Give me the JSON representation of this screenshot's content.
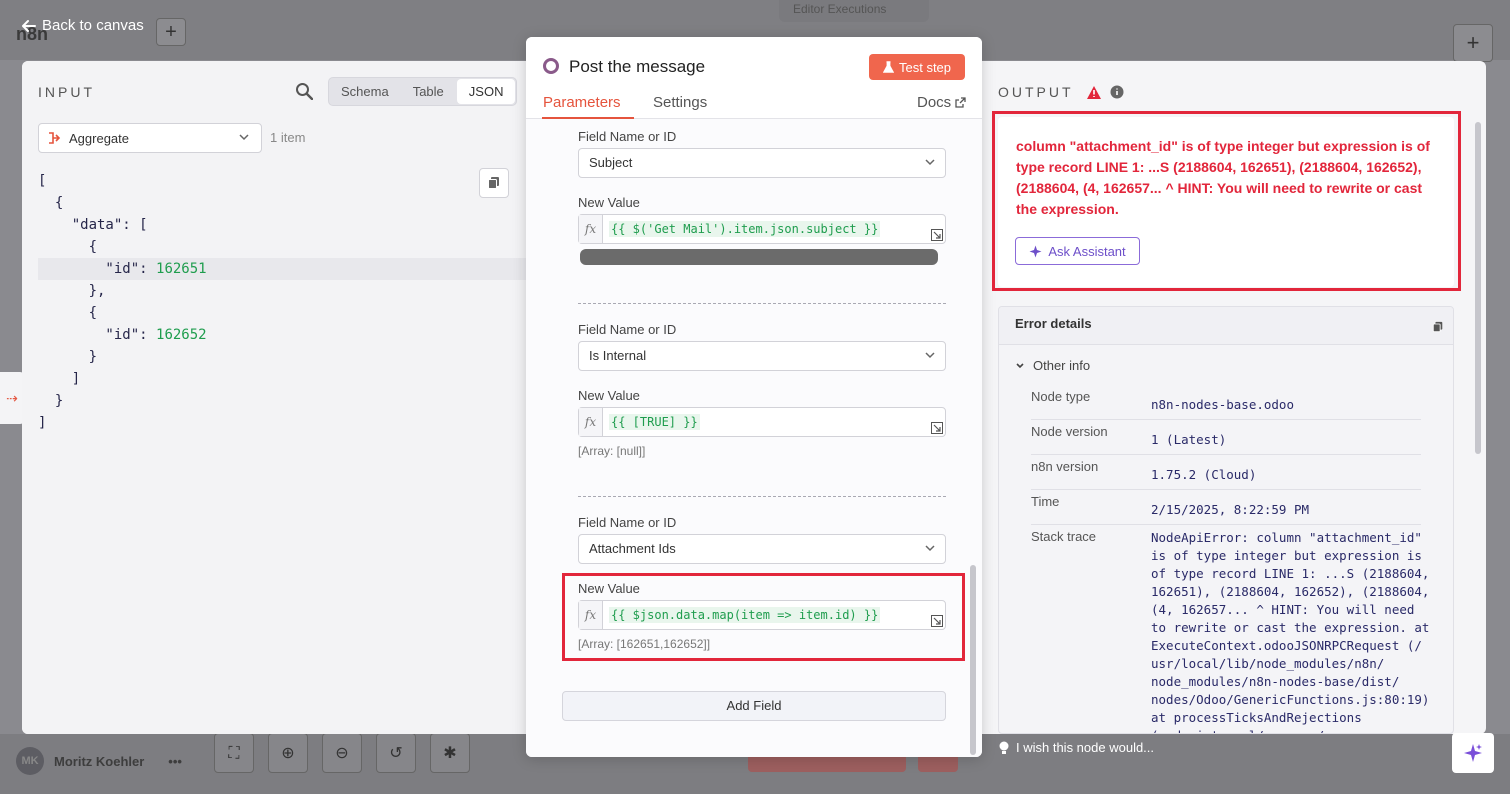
{
  "background": {
    "logo": "n8n",
    "top_tabs": "Editor   Executions",
    "user_initials": "MK",
    "user_name": "Moritz Koehler",
    "user_menu": "•••"
  },
  "back_link": "Back to canvas",
  "input": {
    "label": "INPUT",
    "views": [
      "Schema",
      "Table",
      "JSON"
    ],
    "active_view": "JSON",
    "node_select": "Aggregate",
    "item_count": "1 item",
    "json_lines": [
      "[",
      "  {",
      "    \"data\": [",
      "      {",
      "        \"id\": ",
      "      },",
      "      {",
      "        \"id\": ",
      "      }",
      "    ]",
      "  }",
      "]"
    ],
    "id_values": [
      "162651",
      "162652"
    ]
  },
  "node": {
    "title": "Post the message",
    "test_button": "Test step",
    "tabs": [
      "Parameters",
      "Settings"
    ],
    "docs": "Docs",
    "fields": [
      {
        "name_label": "Field Name or ID",
        "name_value": "Subject",
        "value_label": "New Value",
        "expression": "{{ $('Get Mail').item.json.subject }}",
        "hint": ""
      },
      {
        "name_label": "Field Name or ID",
        "name_value": "Is Internal",
        "value_label": "New Value",
        "expression": "{{ [TRUE] }}",
        "hint": "[Array: [null]]"
      },
      {
        "name_label": "Field Name or ID",
        "name_value": "Attachment Ids",
        "value_label": "New Value",
        "expression": "{{ $json.data.map(item => item.id) }}",
        "hint": "[Array: [162651,162652]]"
      }
    ],
    "add_field": "Add Field"
  },
  "output": {
    "label": "OUTPUT",
    "error_message": "column \"attachment_id\" is of type integer but expression is of type record LINE 1: ...S (2188604, 162651), (2188604, 162652), (2188604, (4, 162657... ^ HINT: You will need to rewrite or cast the expression.",
    "ask_assistant": "Ask Assistant",
    "error_details_title": "Error details",
    "other_info": "Other info",
    "details": [
      {
        "key": "Node type",
        "value": "n8n-nodes-base.odoo"
      },
      {
        "key": "Node version",
        "value": "1 (Latest)"
      },
      {
        "key": "n8n version",
        "value": "1.75.2 (Cloud)"
      },
      {
        "key": "Time",
        "value": "2/15/2025, 8:22:59 PM"
      },
      {
        "key": "Stack trace",
        "value": "NodeApiError: column \"attachment_id\"\nis of type integer but expression is\nof type record LINE 1: ...S (2188604,\n162651), (2188604, 162652), (2188604,\n(4, 162657... ^ HINT: You will need\nto rewrite or cast the expression. at\nExecuteContext.odooJSONRPCRequest (/\nusr/local/lib/node_modules/n8n/\nnode_modules/n8n-nodes-base/dist/\nnodes/Odoo/GenericFunctions.js:80:19)\nat processTicksAndRejections\n(node:internal/process/"
      }
    ],
    "wish": "I wish this node would..."
  },
  "colors": {
    "accent": "#e5543d",
    "error": "#e2263b",
    "assistant": "#6d4fc9",
    "json_number": "#1f9d4e"
  }
}
